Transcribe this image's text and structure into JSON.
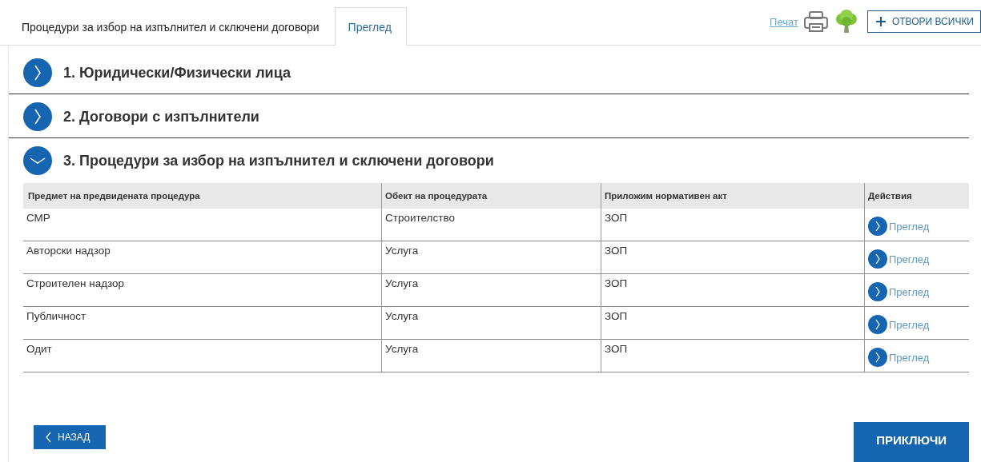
{
  "tabs": [
    {
      "label": "Процедури за избор на изпълнител и сключени договори",
      "selected": false
    },
    {
      "label": "Преглед",
      "selected": true
    }
  ],
  "toolbar": {
    "print_link": "Печат",
    "open_all_button": "ОТВОРИ ВСИЧКИ"
  },
  "sections": [
    {
      "title": "1. Юридически/Физически лица",
      "expanded": false
    },
    {
      "title": "2. Договори с изпълнители",
      "expanded": false
    },
    {
      "title": "3. Процедури за избор на изпълнител и сключени договори",
      "expanded": true
    }
  ],
  "table": {
    "columns": [
      "Предмет на предвидената процедура",
      "Обект на процедурата",
      "Приложим нормативен акт",
      "Действия"
    ],
    "rows": [
      {
        "subject": "СМР",
        "object": "Строителство",
        "act": "ЗОП",
        "action": "Преглед"
      },
      {
        "subject": "Авторски надзор",
        "object": "Услуга",
        "act": "ЗОП",
        "action": "Преглед"
      },
      {
        "subject": "Строителен надзор",
        "object": "Услуга",
        "act": "ЗОП",
        "action": "Преглед"
      },
      {
        "subject": "Публичност",
        "object": "Услуга",
        "act": "ЗОП",
        "action": "Преглед"
      },
      {
        "subject": "Одит",
        "object": "Услуга",
        "act": "ЗОП",
        "action": "Преглед"
      }
    ]
  },
  "back_button": "НАЗАД",
  "finish_button": "ПРИКЛЮЧИ"
}
